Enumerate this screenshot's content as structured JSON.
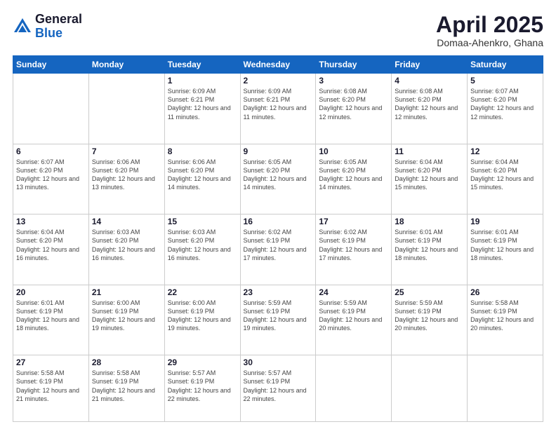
{
  "header": {
    "logo_general": "General",
    "logo_blue": "Blue",
    "month_year": "April 2025",
    "location": "Domaa-Ahenkro, Ghana"
  },
  "weekdays": [
    "Sunday",
    "Monday",
    "Tuesday",
    "Wednesday",
    "Thursday",
    "Friday",
    "Saturday"
  ],
  "weeks": [
    [
      {
        "day": "",
        "info": ""
      },
      {
        "day": "",
        "info": ""
      },
      {
        "day": "1",
        "info": "Sunrise: 6:09 AM\nSunset: 6:21 PM\nDaylight: 12 hours and 11 minutes."
      },
      {
        "day": "2",
        "info": "Sunrise: 6:09 AM\nSunset: 6:21 PM\nDaylight: 12 hours and 11 minutes."
      },
      {
        "day": "3",
        "info": "Sunrise: 6:08 AM\nSunset: 6:20 PM\nDaylight: 12 hours and 12 minutes."
      },
      {
        "day": "4",
        "info": "Sunrise: 6:08 AM\nSunset: 6:20 PM\nDaylight: 12 hours and 12 minutes."
      },
      {
        "day": "5",
        "info": "Sunrise: 6:07 AM\nSunset: 6:20 PM\nDaylight: 12 hours and 12 minutes."
      }
    ],
    [
      {
        "day": "6",
        "info": "Sunrise: 6:07 AM\nSunset: 6:20 PM\nDaylight: 12 hours and 13 minutes."
      },
      {
        "day": "7",
        "info": "Sunrise: 6:06 AM\nSunset: 6:20 PM\nDaylight: 12 hours and 13 minutes."
      },
      {
        "day": "8",
        "info": "Sunrise: 6:06 AM\nSunset: 6:20 PM\nDaylight: 12 hours and 14 minutes."
      },
      {
        "day": "9",
        "info": "Sunrise: 6:05 AM\nSunset: 6:20 PM\nDaylight: 12 hours and 14 minutes."
      },
      {
        "day": "10",
        "info": "Sunrise: 6:05 AM\nSunset: 6:20 PM\nDaylight: 12 hours and 14 minutes."
      },
      {
        "day": "11",
        "info": "Sunrise: 6:04 AM\nSunset: 6:20 PM\nDaylight: 12 hours and 15 minutes."
      },
      {
        "day": "12",
        "info": "Sunrise: 6:04 AM\nSunset: 6:20 PM\nDaylight: 12 hours and 15 minutes."
      }
    ],
    [
      {
        "day": "13",
        "info": "Sunrise: 6:04 AM\nSunset: 6:20 PM\nDaylight: 12 hours and 16 minutes."
      },
      {
        "day": "14",
        "info": "Sunrise: 6:03 AM\nSunset: 6:20 PM\nDaylight: 12 hours and 16 minutes."
      },
      {
        "day": "15",
        "info": "Sunrise: 6:03 AM\nSunset: 6:20 PM\nDaylight: 12 hours and 16 minutes."
      },
      {
        "day": "16",
        "info": "Sunrise: 6:02 AM\nSunset: 6:19 PM\nDaylight: 12 hours and 17 minutes."
      },
      {
        "day": "17",
        "info": "Sunrise: 6:02 AM\nSunset: 6:19 PM\nDaylight: 12 hours and 17 minutes."
      },
      {
        "day": "18",
        "info": "Sunrise: 6:01 AM\nSunset: 6:19 PM\nDaylight: 12 hours and 18 minutes."
      },
      {
        "day": "19",
        "info": "Sunrise: 6:01 AM\nSunset: 6:19 PM\nDaylight: 12 hours and 18 minutes."
      }
    ],
    [
      {
        "day": "20",
        "info": "Sunrise: 6:01 AM\nSunset: 6:19 PM\nDaylight: 12 hours and 18 minutes."
      },
      {
        "day": "21",
        "info": "Sunrise: 6:00 AM\nSunset: 6:19 PM\nDaylight: 12 hours and 19 minutes."
      },
      {
        "day": "22",
        "info": "Sunrise: 6:00 AM\nSunset: 6:19 PM\nDaylight: 12 hours and 19 minutes."
      },
      {
        "day": "23",
        "info": "Sunrise: 5:59 AM\nSunset: 6:19 PM\nDaylight: 12 hours and 19 minutes."
      },
      {
        "day": "24",
        "info": "Sunrise: 5:59 AM\nSunset: 6:19 PM\nDaylight: 12 hours and 20 minutes."
      },
      {
        "day": "25",
        "info": "Sunrise: 5:59 AM\nSunset: 6:19 PM\nDaylight: 12 hours and 20 minutes."
      },
      {
        "day": "26",
        "info": "Sunrise: 5:58 AM\nSunset: 6:19 PM\nDaylight: 12 hours and 20 minutes."
      }
    ],
    [
      {
        "day": "27",
        "info": "Sunrise: 5:58 AM\nSunset: 6:19 PM\nDaylight: 12 hours and 21 minutes."
      },
      {
        "day": "28",
        "info": "Sunrise: 5:58 AM\nSunset: 6:19 PM\nDaylight: 12 hours and 21 minutes."
      },
      {
        "day": "29",
        "info": "Sunrise: 5:57 AM\nSunset: 6:19 PM\nDaylight: 12 hours and 22 minutes."
      },
      {
        "day": "30",
        "info": "Sunrise: 5:57 AM\nSunset: 6:19 PM\nDaylight: 12 hours and 22 minutes."
      },
      {
        "day": "",
        "info": ""
      },
      {
        "day": "",
        "info": ""
      },
      {
        "day": "",
        "info": ""
      }
    ]
  ]
}
